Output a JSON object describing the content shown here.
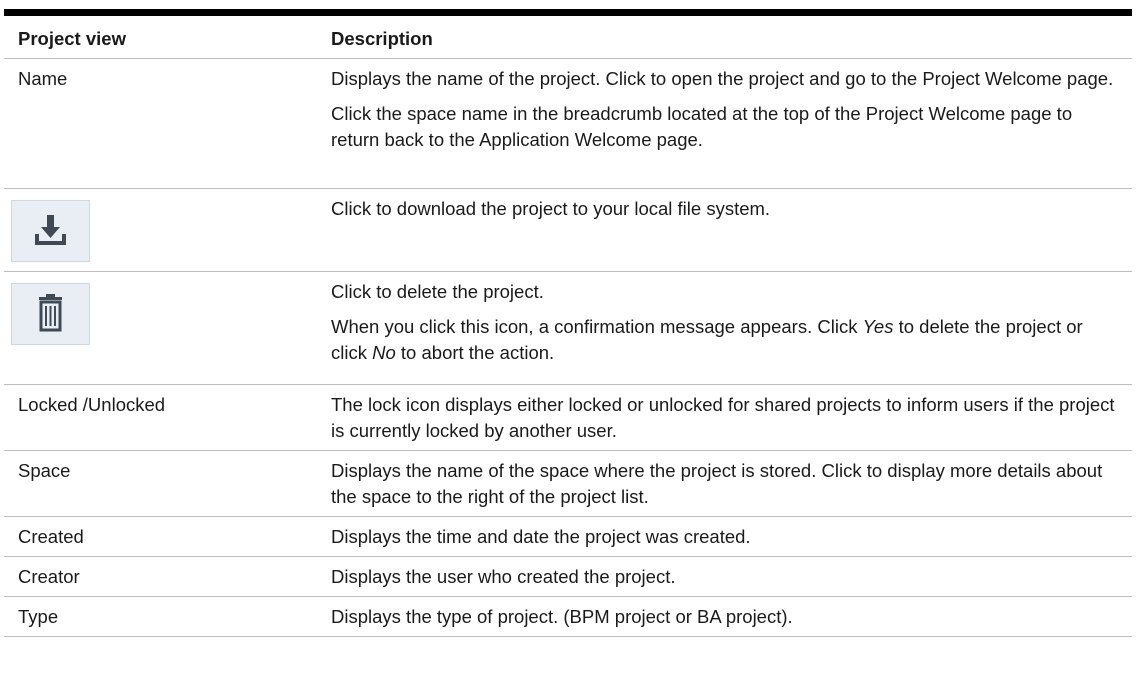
{
  "table": {
    "headers": {
      "view": "Project view",
      "description": "Description"
    },
    "rows": {
      "name": {
        "view": "Name",
        "desc1": "Displays the name of the project. Click to open the project and go to the Project Welcome page.",
        "desc2": "Click the space name in the breadcrumb located at the top of the Project Welcome page to return back to the Application Welcome page."
      },
      "download": {
        "icon": "download-icon",
        "desc": "Click to download the project to your local file system."
      },
      "delete": {
        "icon": "trash-icon",
        "desc1": "Click to delete the project.",
        "desc2_a": "When you click this icon, a confirmation message appears. Click ",
        "desc2_yes": "Yes",
        "desc2_b": " to delete the project or click ",
        "desc2_no": "No",
        "desc2_c": " to abort the action."
      },
      "locked": {
        "view": "Locked /Unlocked",
        "desc": "The lock icon displays either locked or unlocked for shared projects to inform users if the project is currently locked by another user."
      },
      "space": {
        "view": "Space",
        "desc": "Displays the name of the space where the project is stored. Click to display more details about the space to the right of the project list."
      },
      "created": {
        "view": "Created",
        "desc": "Displays the time and date the project was created."
      },
      "creator": {
        "view": "Creator",
        "desc": "Displays the user who created the project."
      },
      "type": {
        "view": "Type",
        "desc": "Displays the type of project. (BPM project or BA project)."
      }
    }
  },
  "colors": {
    "icon_bg": "#e9eef5",
    "icon_fg": "#3f4a56",
    "rule": "#000000",
    "divider": "#bdbdbd"
  }
}
